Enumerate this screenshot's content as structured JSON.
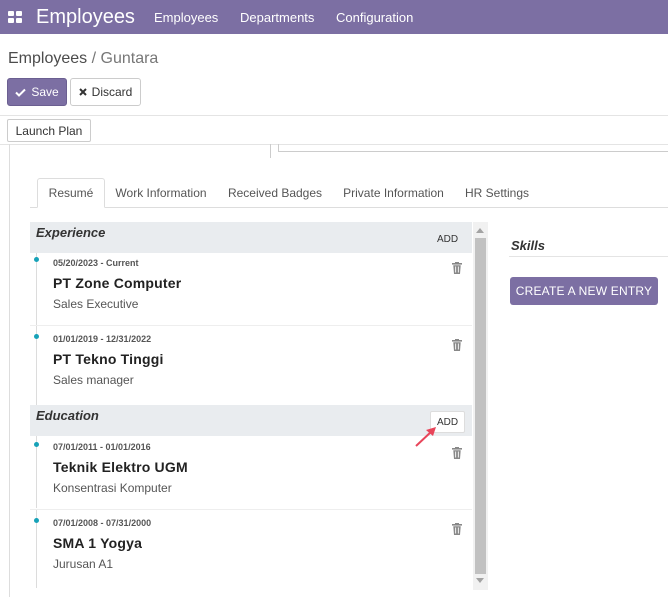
{
  "nav": {
    "brand": "Employees",
    "menu": [
      "Employees",
      "Departments",
      "Configuration"
    ]
  },
  "breadcrumb": {
    "parent": "Employees",
    "separator": " / ",
    "current": "Guntara"
  },
  "toolbar": {
    "save_label": "Save",
    "discard_label": "Discard",
    "launch_plan_label": "Launch Plan"
  },
  "tabs": [
    "Resumé",
    "Work Information",
    "Received Badges",
    "Private Information",
    "HR Settings"
  ],
  "active_tab": "Resumé",
  "resume": {
    "experience": {
      "title": "Experience",
      "add_label": "ADD",
      "lines": [
        {
          "date": "05/20/2023 - Current",
          "name": "PT Zone Computer",
          "description": "Sales Executive"
        },
        {
          "date": "01/01/2019 - 12/31/2022",
          "name": "PT Tekno Tinggi",
          "description": "Sales manager"
        }
      ]
    },
    "education": {
      "title": "Education",
      "add_label": "ADD",
      "lines": [
        {
          "date": "07/01/2011 - 01/01/2016",
          "name": "Teknik Elektro UGM",
          "description": "Konsentrasi Komputer"
        },
        {
          "date": "07/01/2008 - 07/31/2000",
          "name": "SMA 1 Yogya",
          "description": "Jurusan A1"
        }
      ]
    }
  },
  "skills": {
    "title": "Skills",
    "create_label": "CREATE A NEW ENTRY"
  },
  "colors": {
    "brand": "#7c6fa3",
    "timeline_dot": "#17a2b8",
    "section_bg": "#e9ecef",
    "pointer": "#e8455a"
  }
}
